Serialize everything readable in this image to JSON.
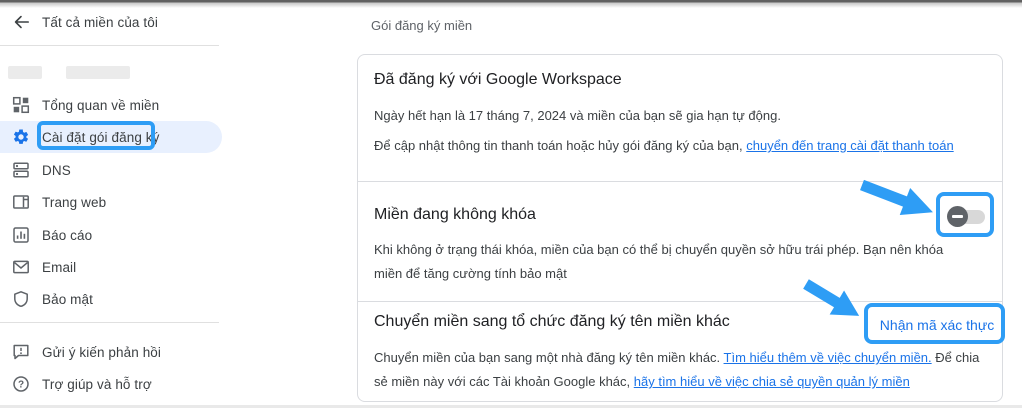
{
  "colors": {
    "accent_blue": "#1a73e8",
    "annotation_blue": "#2e9df5",
    "selected_item_bg": "#e8f0fe",
    "card_border": "#dadce0"
  },
  "sidebar": {
    "back": {
      "label": "Tất cả miền của tôi",
      "icon": "back-arrow-icon"
    },
    "domain_placeholder": "redacted-domain-name",
    "items": [
      {
        "label": "Tổng quan về miền",
        "icon": "dashboard-icon",
        "selected": false
      },
      {
        "label": "Cài đặt gói đăng ký",
        "icon": "gear-icon",
        "selected": true,
        "annotated": true
      },
      {
        "label": "DNS",
        "icon": "dns-icon",
        "selected": false
      },
      {
        "label": "Trang web",
        "icon": "browser-icon",
        "selected": false
      },
      {
        "label": "Báo cáo",
        "icon": "bar-chart-icon",
        "selected": false
      },
      {
        "label": "Email",
        "icon": "envelope-icon",
        "selected": false
      },
      {
        "label": "Bảo mật",
        "icon": "shield-icon",
        "selected": false
      }
    ],
    "footer_items": [
      {
        "label": "Gửi ý kiến phản hồi",
        "icon": "feedback-icon"
      },
      {
        "label": "Trợ giúp và hỗ trợ",
        "icon": "help-icon"
      }
    ]
  },
  "main": {
    "header": "Gói đăng ký miền",
    "workspace_section": {
      "title": "Đã đăng ký với Google Workspace",
      "expiry_text": "Ngày hết hạn là 17 tháng 7, 2024 và miền của bạn sẽ gia hạn tự động.",
      "billing_text_prefix": "Để cập nhật thông tin thanh toán hoặc hủy gói đăng ký của bạn, ",
      "billing_link": "chuyển đến trang cài đặt thanh toán"
    },
    "lock_section": {
      "title": "Miền đang không khóa",
      "body": "Khi không ở trạng thái khóa, miền của bạn có thể bị chuyển quyền sở hữu trái phép. Bạn nên khóa miền để tăng cường tính bảo mật",
      "toggle_state": "off"
    },
    "transfer_section": {
      "title": "Chuyển miền sang tổ chức đăng ký tên miền khác",
      "button_label": "Nhận mã xác thực",
      "body_prefix": "Chuyển miền của bạn sang một nhà đăng ký tên miền khác. ",
      "transfer_link": "Tìm hiểu thêm về việc chuyển miền.",
      "body_middle": " Để chia sẻ miền này với các Tài khoản Google khác, ",
      "share_link": "hãy tìm hiểu về việc chia sẻ quyền quản lý miền"
    }
  }
}
